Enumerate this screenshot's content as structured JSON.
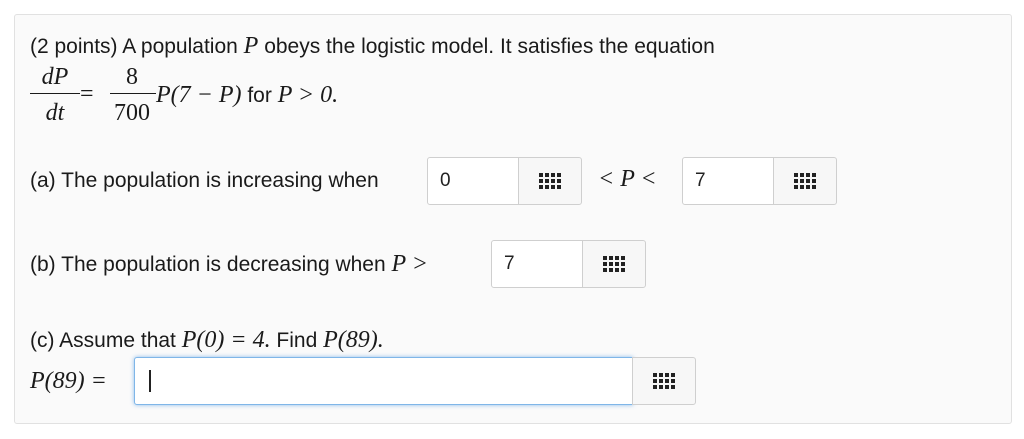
{
  "question": {
    "points_label": "(2 points) A population",
    "var_P": "P",
    "intro_rest": "obeys the logistic model. It satisfies the equation",
    "eq_dP": "dP",
    "eq_dt": "dt",
    "eq_equals": "=",
    "eq_num": "8",
    "eq_den": "700",
    "eq_rhs": "P(7 − P)",
    "eq_for": "for",
    "eq_cond": "P > 0."
  },
  "part_a": {
    "label": "(a) The population is increasing when",
    "input1_value": "0",
    "between": "< P <",
    "input2_value": "7"
  },
  "part_b": {
    "label": "(b) The population is decreasing when",
    "cond": "P >",
    "input_value": "7"
  },
  "part_c": {
    "label_pre": "(c) Assume that",
    "given": "P(0) = 4.",
    "find_word": "Find",
    "find": "P(89).",
    "answer_label": "P(89) =",
    "input_value": ""
  },
  "icons": {
    "keyboard": "keyboard-grid-icon"
  }
}
